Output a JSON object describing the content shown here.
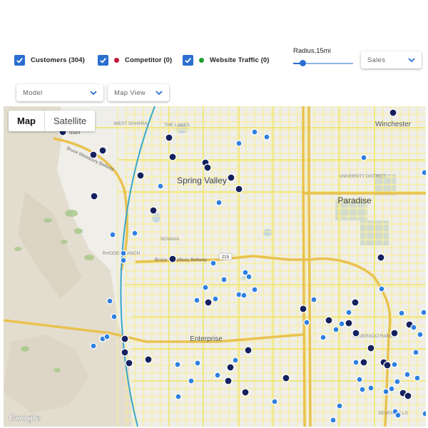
{
  "filters": {
    "customers": {
      "label": "Customers (304)",
      "checked": true
    },
    "competitor": {
      "label": "Competitor (0)",
      "checked": true,
      "dot_color": "#c2163a"
    },
    "website_traffic": {
      "label": "Website Traffic (0)",
      "checked": true,
      "dot_color": "#1e9e2e"
    }
  },
  "radius": {
    "label": "Radius,15mi",
    "value_fraction": 0.15
  },
  "dropdowns": {
    "sales": "Sales",
    "model": "Model",
    "map_view": "Map View"
  },
  "map": {
    "type_buttons": [
      "Map",
      "Satellite"
    ],
    "active_type": "Map",
    "labels": {
      "winchester": "Winchester",
      "spring_valley": "Spring Valley",
      "paradise": "Paradise",
      "enterprise": "Enterprise",
      "university_district": "UNIVERSITY DISTRICT",
      "west_sahara": "WEST SAHARA",
      "the_lakes": "THE LAKES",
      "sovana": "SOVANA",
      "rhodes_ranch": "RHODES RANCH",
      "silverado_ranch": "SILVERADO RANCH",
      "seven_hills": "SEVEN HILLS",
      "south": "outh",
      "beltway_nw": "Bruce Woodbury Beltway",
      "beltway_s": "Bruce Woodbury Beltway",
      "route_215": "215"
    },
    "attribution": "Google",
    "colors": {
      "customer_dark": "#15205e",
      "customer_light": "#2f80e0",
      "road": "#f4e56a",
      "highway": "#e8c24a",
      "radius_circle": "#3aa8c8"
    }
  }
}
